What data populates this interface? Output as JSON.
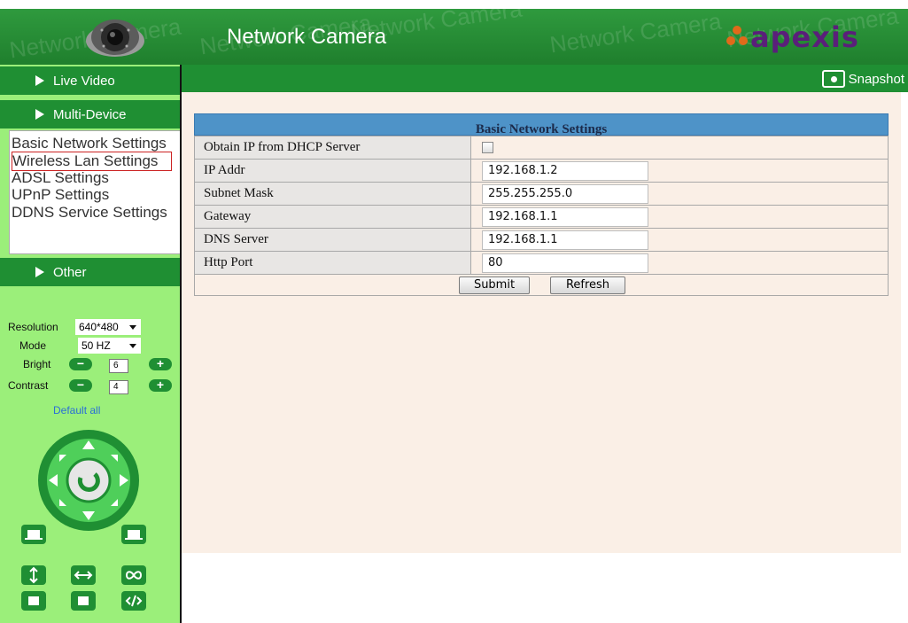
{
  "header": {
    "title": "Network Camera",
    "watermark": "Network Camera",
    "brand": "apexis",
    "brand_color": "#5a1f7a"
  },
  "sidebar": {
    "live_video": "Live Video",
    "multi_device": "Multi-Device",
    "submenu": [
      "Basic Network Settings",
      "Wireless Lan Settings",
      "ADSL Settings",
      "UPnP Settings",
      "DDNS Service Settings"
    ],
    "other": "Other",
    "controls": {
      "resolution_label": "Resolution",
      "resolution_value": "640*480",
      "mode_label": "Mode",
      "mode_value": "50 HZ",
      "bright_label": "Bright",
      "bright_value": "6",
      "contrast_label": "Contrast",
      "contrast_value": "4",
      "minus": "−",
      "plus": "+",
      "default_all": "Default all"
    }
  },
  "topbar": {
    "snapshot": "Snapshot"
  },
  "panel": {
    "title": "Basic Network Settings",
    "rows": [
      {
        "label": "Obtain IP from DHCP Server",
        "type": "checkbox",
        "value": ""
      },
      {
        "label": "IP Addr",
        "type": "text",
        "value": "192.168.1.2"
      },
      {
        "label": "Subnet Mask",
        "type": "text",
        "value": "255.255.255.0"
      },
      {
        "label": "Gateway",
        "type": "text",
        "value": "192.168.1.1"
      },
      {
        "label": "DNS Server",
        "type": "text",
        "value": "192.168.1.1"
      },
      {
        "label": "Http Port",
        "type": "text",
        "value": "80"
      }
    ],
    "submit": "Submit",
    "refresh": "Refresh"
  },
  "colors": {
    "header_green": "#2f9a3e",
    "bar_green": "#1f8f33",
    "sidebar_green": "#9bef7a",
    "panel_header_blue": "#4e93c8",
    "content_bg": "#faefe6",
    "selected_outline": "#cc2222",
    "link_blue": "#2a6fd6"
  },
  "icons": [
    "camera-dome-image",
    "apexis-logo-icon",
    "snapshot-camera-icon",
    "ptz-joystick-icon",
    "ptz-preset-icons"
  ]
}
